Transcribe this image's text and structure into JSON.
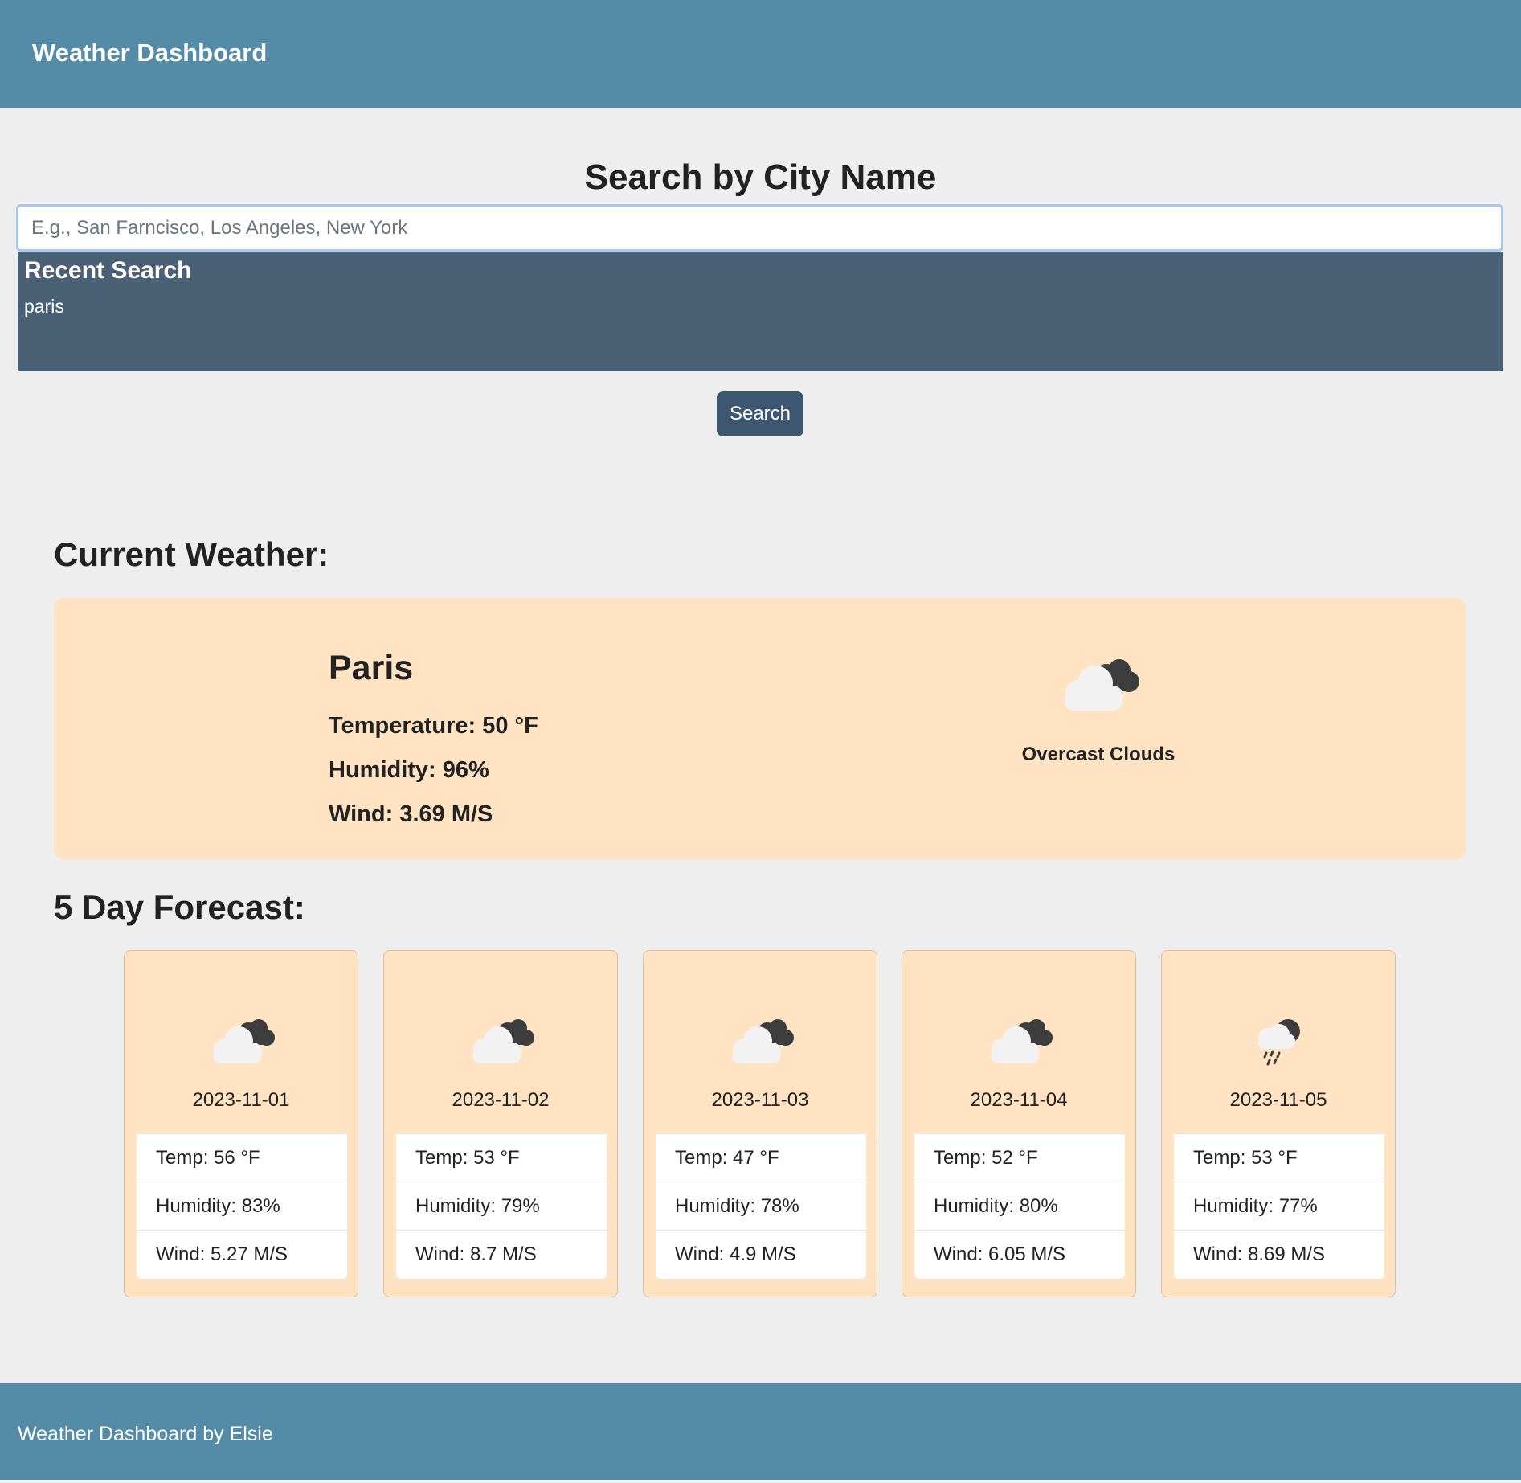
{
  "header": {
    "brand": "Weather Dashboard"
  },
  "search": {
    "title": "Search by City Name",
    "placeholder": "E.g., San Farncisco, Los Angeles, New York",
    "value": "",
    "button_label": "Search"
  },
  "recent": {
    "title": "Recent Search",
    "items": [
      "paris"
    ]
  },
  "current": {
    "heading": "Current Weather:",
    "city": "Paris",
    "temperature": "Temperature: 50 °F",
    "humidity": "Humidity: 96%",
    "wind": "Wind: 3.69 M/S",
    "description": "Overcast Clouds",
    "icon": "overcast-clouds-icon"
  },
  "forecast": {
    "heading": "5 Day Forecast:",
    "days": [
      {
        "date": "2023-11-01",
        "temp": "Temp: 56 °F",
        "humidity": "Humidity: 83%",
        "wind": "Wind: 5.27 M/S",
        "icon": "overcast-clouds-icon"
      },
      {
        "date": "2023-11-02",
        "temp": "Temp: 53 °F",
        "humidity": "Humidity: 79%",
        "wind": "Wind: 8.7 M/S",
        "icon": "overcast-clouds-icon"
      },
      {
        "date": "2023-11-03",
        "temp": "Temp: 47 °F",
        "humidity": "Humidity: 78%",
        "wind": "Wind: 4.9 M/S",
        "icon": "overcast-clouds-icon"
      },
      {
        "date": "2023-11-04",
        "temp": "Temp: 52 °F",
        "humidity": "Humidity: 80%",
        "wind": "Wind: 6.05 M/S",
        "icon": "overcast-clouds-icon"
      },
      {
        "date": "2023-11-05",
        "temp": "Temp: 53 °F",
        "humidity": "Humidity: 77%",
        "wind": "Wind: 8.69 M/S",
        "icon": "light-rain-icon"
      }
    ]
  },
  "footer": {
    "text": "Weather Dashboard by Elsie"
  },
  "colors": {
    "navbar": "#548ca8",
    "recent_panel": "#4a6074",
    "button": "#3e5770",
    "card": "#ffe3c2",
    "background": "#eeeeee"
  }
}
